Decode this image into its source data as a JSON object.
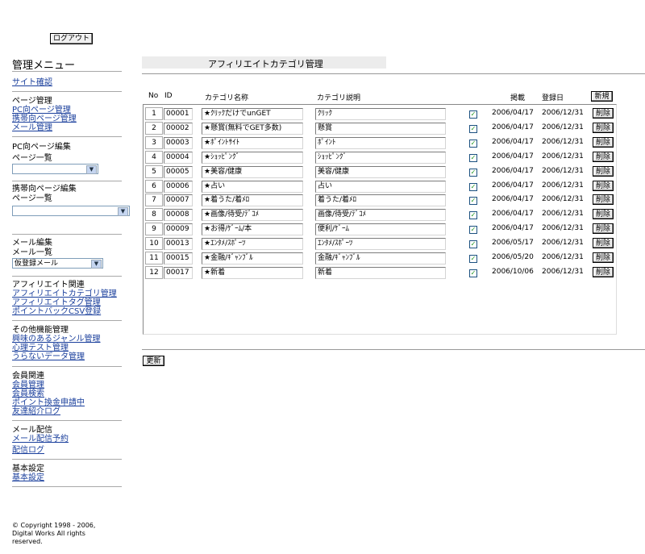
{
  "header": {
    "logout_label": "ログアウト"
  },
  "sidebar": {
    "menu_title": "管理メニュー",
    "site_confirm": "サイト確認",
    "page_mgmt": {
      "heading": "ページ管理",
      "links": [
        "PC向ページ管理",
        "携帯向ページ管理",
        "メール管理"
      ]
    },
    "pc_edit": {
      "heading": "PC向ページ編集",
      "sub": "ページ一覧",
      "select_value": ""
    },
    "mobile_edit": {
      "heading": "携帯向ページ編集",
      "sub": "ページ一覧",
      "select_value": ""
    },
    "mail_edit": {
      "heading": "メール編集",
      "sub": "メール一覧",
      "select_value": "仮登録メール"
    },
    "affiliate": {
      "heading": "アフィリエイト関連",
      "links": [
        "アフィリエイトカテゴリ管理",
        "アフィリエイトタグ管理",
        "ポイントバックCSV登録"
      ]
    },
    "other": {
      "heading": "その他機能管理",
      "links": [
        "興味のあるジャンル管理",
        "心理テスト管理",
        "うらないデータ管理"
      ]
    },
    "members": {
      "heading": "会員関連",
      "links": [
        "会員管理",
        "会員検索",
        "ポイント換金申請中",
        "友達紹介ログ"
      ]
    },
    "mail_send": {
      "heading": "メール配信",
      "links": [
        "メール配信予約",
        "配信ログ"
      ]
    },
    "basic": {
      "heading": "基本設定",
      "links": [
        "基本設定"
      ]
    },
    "copyright": "© Copyright 1998 - 2006, Digital Works All rights reserved."
  },
  "main": {
    "title": "アフィリエイトカテゴリ管理",
    "columns": {
      "no": "No",
      "id": "ID",
      "name": "カテゴリ名称",
      "desc": "カテゴリ説明",
      "published": "掲載",
      "registered": "登録日"
    },
    "new_label": "新規",
    "delete_label": "削除",
    "update_label": "更新",
    "rows": [
      {
        "no": "1",
        "id": "00001",
        "name": "★ｸﾘｯｸだけでunGET",
        "desc": "ｸﾘｯｸ",
        "checked": true,
        "pub": "2006/04/17",
        "reg": "2006/12/31"
      },
      {
        "no": "2",
        "id": "00002",
        "name": "★懸賞(無料でGET多数)",
        "desc": "懸賞",
        "checked": true,
        "pub": "2006/04/17",
        "reg": "2006/12/31"
      },
      {
        "no": "3",
        "id": "00003",
        "name": "★ﾎﾟｲﾝﾄｻｲﾄ",
        "desc": "ﾎﾟｲﾝﾄ",
        "checked": true,
        "pub": "2006/04/17",
        "reg": "2006/12/31"
      },
      {
        "no": "4",
        "id": "00004",
        "name": "★ｼｮｯﾋﾟﾝｸﾞ",
        "desc": "ｼｮｯﾋﾟﾝｸﾞ",
        "checked": true,
        "pub": "2006/04/17",
        "reg": "2006/12/31"
      },
      {
        "no": "5",
        "id": "00005",
        "name": "★美容/健康",
        "desc": "美容/健康",
        "checked": true,
        "pub": "2006/04/17",
        "reg": "2006/12/31"
      },
      {
        "no": "6",
        "id": "00006",
        "name": "★占い",
        "desc": "占い",
        "checked": true,
        "pub": "2006/04/17",
        "reg": "2006/12/31"
      },
      {
        "no": "7",
        "id": "00007",
        "name": "★着うた/着ﾒﾛ",
        "desc": "着うた/着ﾒﾛ",
        "checked": true,
        "pub": "2006/04/17",
        "reg": "2006/12/31"
      },
      {
        "no": "8",
        "id": "00008",
        "name": "★画像/待受/ﾃﾞｺﾒ",
        "desc": "画像/待受/ﾃﾞｺﾒ",
        "checked": true,
        "pub": "2006/04/17",
        "reg": "2006/12/31"
      },
      {
        "no": "9",
        "id": "00009",
        "name": "★お得/ｹﾞｰﾑ/本",
        "desc": "便利/ｹﾞｰﾑ",
        "checked": true,
        "pub": "2006/04/17",
        "reg": "2006/12/31"
      },
      {
        "no": "10",
        "id": "00013",
        "name": "★ｴﾝﾀﾒ/ｽﾎﾟｰﾂ",
        "desc": "ｴﾝﾀﾒ/ｽﾎﾟｰﾂ",
        "checked": true,
        "pub": "2006/05/17",
        "reg": "2006/12/31"
      },
      {
        "no": "11",
        "id": "00015",
        "name": "★金融/ｷﾞｬﾝﾌﾞﾙ",
        "desc": "金融/ｷﾞｬﾝﾌﾞﾙ",
        "checked": true,
        "pub": "2006/05/20",
        "reg": "2006/12/31"
      },
      {
        "no": "12",
        "id": "00017",
        "name": "★新着",
        "desc": "新着",
        "checked": true,
        "pub": "2006/10/06",
        "reg": "2006/12/31"
      }
    ]
  }
}
